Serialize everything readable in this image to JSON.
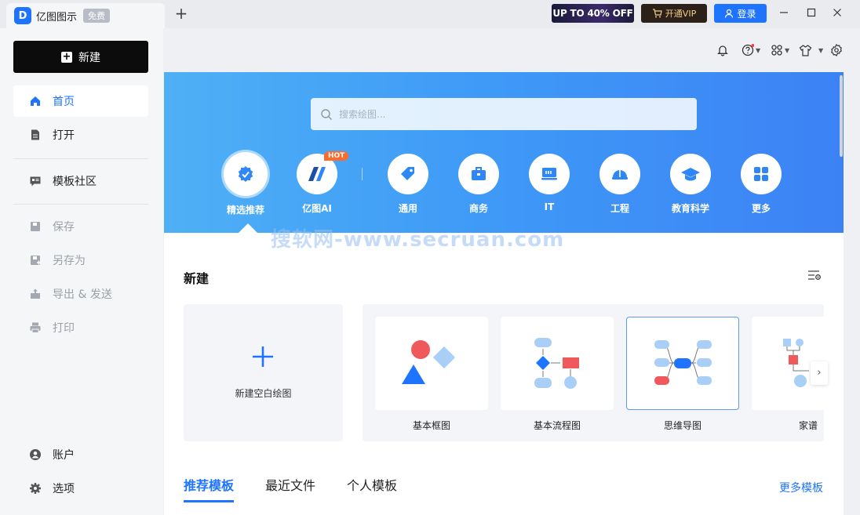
{
  "titlebar": {
    "app_name": "亿图图示",
    "free_badge": "免费",
    "new_tab": "+",
    "promo": "UP TO 40% OFF",
    "vip_label": "开通VIP",
    "login_label": "登录"
  },
  "sidebar": {
    "new_label": "新建",
    "items": [
      {
        "label": "首页",
        "icon": "home-icon"
      },
      {
        "label": "打开",
        "icon": "file-icon"
      },
      {
        "label": "模板社区",
        "icon": "template-community-icon"
      },
      {
        "label": "保存",
        "icon": "save-icon"
      },
      {
        "label": "另存为",
        "icon": "save-as-icon"
      },
      {
        "label": "导出 & 发送",
        "icon": "export-icon"
      },
      {
        "label": "打印",
        "icon": "print-icon"
      },
      {
        "label": "账户",
        "icon": "account-icon"
      },
      {
        "label": "选项",
        "icon": "settings-icon"
      }
    ]
  },
  "search": {
    "placeholder": "搜索绘图..."
  },
  "categories": [
    {
      "label": "精选推荐",
      "icon": "featured-icon"
    },
    {
      "label": "亿图AI",
      "icon": "ai-icon",
      "badge": "HOT"
    },
    {
      "label": "通用",
      "icon": "tag-icon"
    },
    {
      "label": "商务",
      "icon": "briefcase-icon"
    },
    {
      "label": "IT",
      "icon": "monitor-icon"
    },
    {
      "label": "工程",
      "icon": "helmet-icon"
    },
    {
      "label": "教育科学",
      "icon": "graduation-cap-icon"
    },
    {
      "label": "更多",
      "icon": "grid-icon"
    }
  ],
  "watermark": "搜软网-www.secruan.com",
  "new_section": {
    "title": "新建",
    "blank_label": "新建空白绘图",
    "templates": [
      "基本框图",
      "基本流程图",
      "思维导图",
      "家谱"
    ]
  },
  "tabs": [
    "推荐模板",
    "最近文件",
    "个人模板"
  ],
  "more_templates": "更多模板",
  "colors": {
    "accent": "#1e74ff",
    "hero_start": "#4fb0f5",
    "hero_end": "#3c82f5",
    "hot": "#ff6a2b"
  }
}
